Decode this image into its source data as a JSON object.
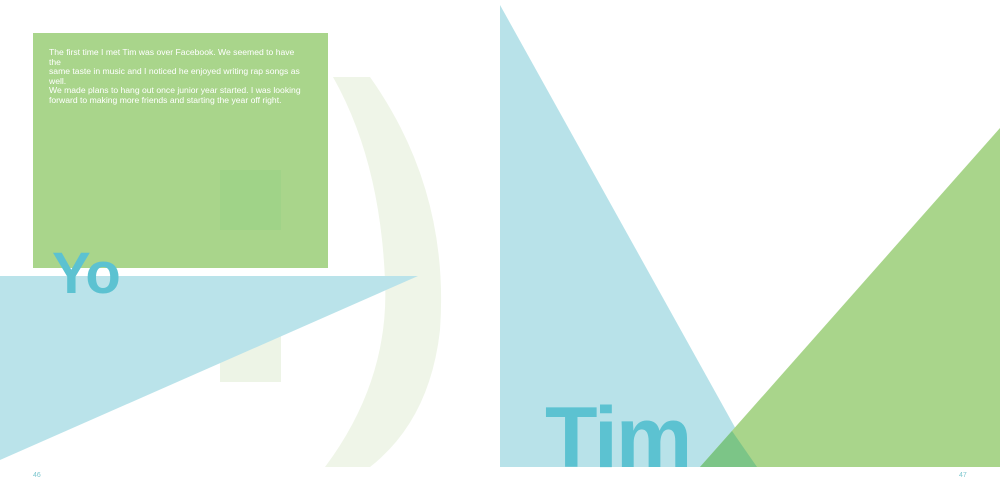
{
  "left_page": {
    "story_text": "The first time I met Tim was over Facebook. We seemed to have the\nsame taste in music and I noticed he enjoyed writing rap songs as well.\nWe made plans to hang out once junior year started. I was looking\nforward to making more friends and starting the year off right.",
    "headline": "Yo",
    "page_number": "46"
  },
  "right_page": {
    "headline": "Tim",
    "page_number": "47"
  },
  "colors": {
    "green": "#a9d58b",
    "blue": "#5cc2d1",
    "light_blue": "#b8e2e9",
    "faint_green": "#eff5e8",
    "overlap_green": "#7cc587"
  }
}
